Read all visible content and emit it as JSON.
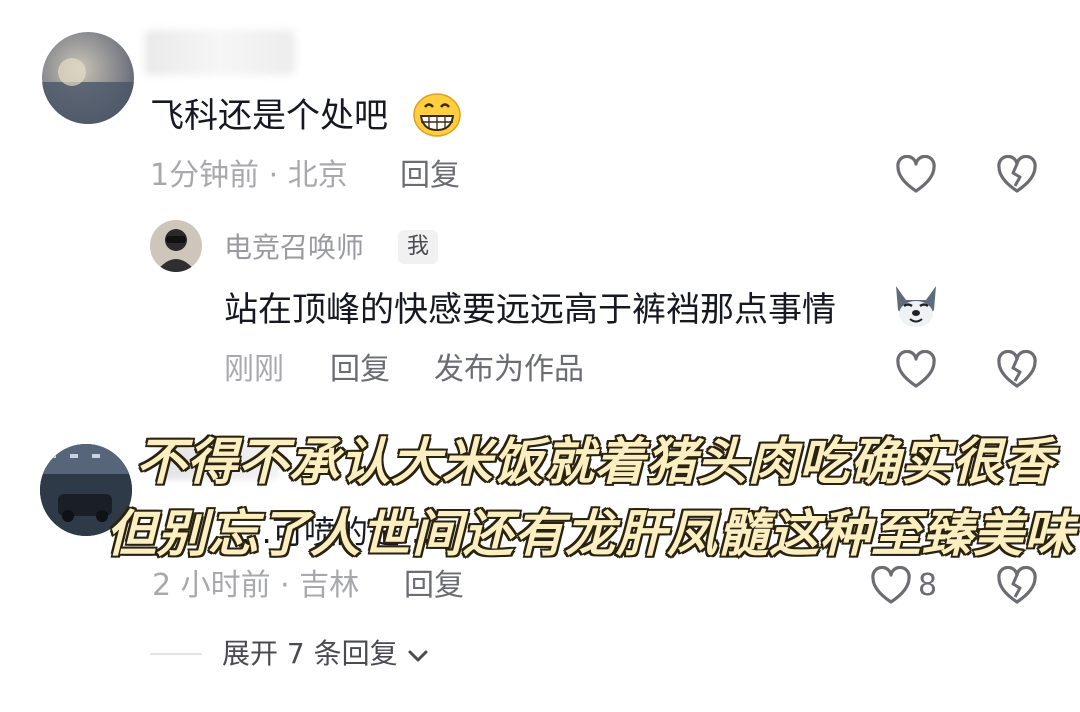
{
  "comment1": {
    "text": "飞科还是个处吧",
    "emoji_icon": "grinning-face-icon",
    "time_location": "1分钟前 · 北京",
    "reply_label": "回复"
  },
  "reply1": {
    "username": "电竞召唤师",
    "badge": "我",
    "text": "站在顶峰的快感要远远高于裤裆那点事情",
    "emoji_icon": "wolf-face-icon",
    "time": "刚刚",
    "reply_label": "回复",
    "publish_label": "发布为作品"
  },
  "comment2": {
    "partial_text": "…可喷的是…",
    "time_location": "2 小时前 · 吉林",
    "reply_label": "回复",
    "like_count": "8"
  },
  "caption": {
    "line1": "不得不承认大米饭就着猪头肉吃确实很香",
    "line2": "但别忘了人世间还有龙肝凤髓这种至臻美味"
  },
  "expand": {
    "label": "展开 7 条回复"
  },
  "colors": {
    "text_primary": "#161823",
    "text_meta": "#a8a9ad",
    "caption_fill": "#fbeec0",
    "caption_stroke": "#2a2310"
  }
}
